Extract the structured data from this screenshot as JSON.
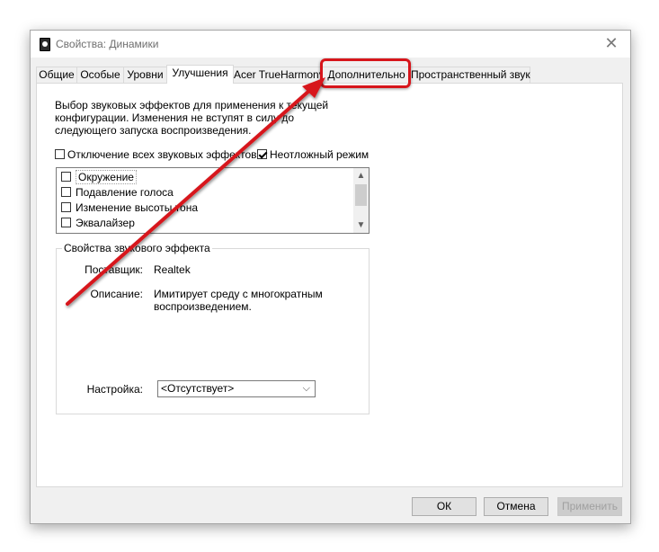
{
  "window": {
    "title": "Свойства: Динамики",
    "close_icon": "close-icon"
  },
  "tabs": [
    {
      "label": "Общие",
      "active": false
    },
    {
      "label": "Особые",
      "active": false
    },
    {
      "label": "Уровни",
      "active": false
    },
    {
      "label": "Улучшения",
      "active": true
    },
    {
      "label": "Acer TrueHarmony",
      "active": false
    },
    {
      "label": "Дополнительно",
      "active": false,
      "highlighted": true
    },
    {
      "label": "Пространственный звук",
      "active": false
    }
  ],
  "enhancements": {
    "description": "Выбор звуковых эффектов для применения к текущей конфигурации. Изменения не вступят в силу до следующего запуска воспроизведения.",
    "disable_all": {
      "label": "Отключение всех звуковых эффектов",
      "checked": false
    },
    "immediate_mode": {
      "label": "Неотложный режим",
      "checked": true
    },
    "effects": [
      {
        "label": "Окружение",
        "checked": false
      },
      {
        "label": "Подавление голоса",
        "checked": false
      },
      {
        "label": "Изменение высоты тона",
        "checked": false
      },
      {
        "label": "Эквалайзер",
        "checked": false
      }
    ],
    "properties": {
      "title": "Свойства звукового эффекта",
      "provider_label": "Поставщик:",
      "provider_value": "Realtek",
      "description_label": "Описание:",
      "description_value": "Имитирует среду с многократным воспроизведением.",
      "setting_label": "Настройка:",
      "setting_value": "<Отсутствует>"
    }
  },
  "buttons": {
    "ok": "ОК",
    "cancel": "Отмена",
    "apply": "Применить"
  },
  "annotation": {
    "color": "#d7151b"
  }
}
